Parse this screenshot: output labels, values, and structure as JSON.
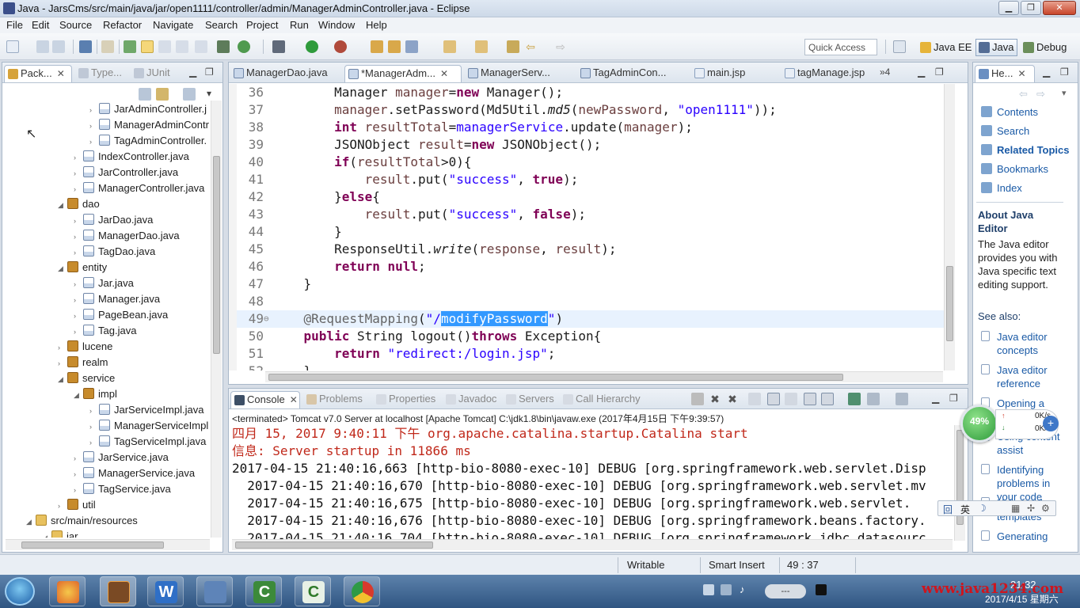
{
  "window": {
    "title": "Java - JarsCms/src/main/java/jar/open1111/controller/admin/ManagerAdminController.java - Eclipse",
    "controls": [
      "▁",
      "❐",
      "✕"
    ]
  },
  "menu": [
    "File",
    "Edit",
    "Source",
    "Refactor",
    "Navigate",
    "Search",
    "Project",
    "Run",
    "Window",
    "Help"
  ],
  "toolbar": {
    "quick_access": "Quick Access",
    "perspectives": [
      {
        "label": "Java EE",
        "active": false
      },
      {
        "label": "Java",
        "active": true
      },
      {
        "label": "Debug",
        "active": false
      }
    ]
  },
  "explorer": {
    "tabs": [
      {
        "label": "Pack...",
        "active": true
      },
      {
        "label": "Type...",
        "active": false
      },
      {
        "label": "JUnit",
        "active": false
      }
    ],
    "items": [
      {
        "label": "JarAdminController.j",
        "kind": "java",
        "level": 5,
        "toggle": "›"
      },
      {
        "label": "ManagerAdminContr",
        "kind": "java",
        "level": 5,
        "toggle": "›"
      },
      {
        "label": "TagAdminController.",
        "kind": "java",
        "level": 5,
        "toggle": "›"
      },
      {
        "label": "IndexController.java",
        "kind": "java",
        "level": 4,
        "toggle": "›"
      },
      {
        "label": "JarController.java",
        "kind": "java",
        "level": 4,
        "toggle": "›"
      },
      {
        "label": "ManagerController.java",
        "kind": "java",
        "level": 4,
        "toggle": "›"
      },
      {
        "label": "dao",
        "kind": "package",
        "level": 3,
        "toggle": "◢"
      },
      {
        "label": "JarDao.java",
        "kind": "java",
        "level": 4,
        "toggle": "›"
      },
      {
        "label": "ManagerDao.java",
        "kind": "java",
        "level": 4,
        "toggle": "›"
      },
      {
        "label": "TagDao.java",
        "kind": "java",
        "level": 4,
        "toggle": "›"
      },
      {
        "label": "entity",
        "kind": "package",
        "level": 3,
        "toggle": "◢"
      },
      {
        "label": "Jar.java",
        "kind": "java",
        "level": 4,
        "toggle": "›"
      },
      {
        "label": "Manager.java",
        "kind": "java",
        "level": 4,
        "toggle": "›"
      },
      {
        "label": "PageBean.java",
        "kind": "java",
        "level": 4,
        "toggle": "›"
      },
      {
        "label": "Tag.java",
        "kind": "java",
        "level": 4,
        "toggle": "›"
      },
      {
        "label": "lucene",
        "kind": "package",
        "level": 3,
        "toggle": "›"
      },
      {
        "label": "realm",
        "kind": "package",
        "level": 3,
        "toggle": "›"
      },
      {
        "label": "service",
        "kind": "package",
        "level": 3,
        "toggle": "◢"
      },
      {
        "label": "impl",
        "kind": "package",
        "level": 4,
        "toggle": "◢"
      },
      {
        "label": "JarServiceImpl.java",
        "kind": "java",
        "level": 5,
        "toggle": "›"
      },
      {
        "label": "ManagerServiceImpl",
        "kind": "java",
        "level": 5,
        "toggle": "›"
      },
      {
        "label": "TagServiceImpl.java",
        "kind": "java",
        "level": 5,
        "toggle": "›"
      },
      {
        "label": "JarService.java",
        "kind": "java",
        "level": 4,
        "toggle": "›"
      },
      {
        "label": "ManagerService.java",
        "kind": "java",
        "level": 4,
        "toggle": "›"
      },
      {
        "label": "TagService.java",
        "kind": "java",
        "level": 4,
        "toggle": "›"
      },
      {
        "label": "util",
        "kind": "package",
        "level": 3,
        "toggle": "›"
      },
      {
        "label": "src/main/resources",
        "kind": "folder",
        "level": 1,
        "toggle": "◢"
      },
      {
        "label": "jar",
        "kind": "folder",
        "level": 2,
        "toggle": "◢"
      }
    ]
  },
  "editor": {
    "tabs": [
      {
        "label": "ManagerDao.java",
        "active": false,
        "closable": false
      },
      {
        "label": "*ManagerAdm...",
        "active": true,
        "closable": true
      },
      {
        "label": "ManagerServ...",
        "active": false,
        "closable": false
      },
      {
        "label": "TagAdminCon...",
        "active": false,
        "closable": false
      },
      {
        "label": "main.jsp",
        "active": false,
        "closable": false
      },
      {
        "label": "tagManage.jsp",
        "active": false,
        "closable": false
      }
    ],
    "overflow": "»4",
    "lines": [
      {
        "n": "36",
        "tokens": [
          {
            "t": "        Manager "
          },
          {
            "t": "manager",
            "c": "var"
          },
          {
            "t": "="
          },
          {
            "t": "new",
            "c": "kw"
          },
          {
            "t": " Manager();"
          }
        ]
      },
      {
        "n": "37",
        "tokens": [
          {
            "t": "        "
          },
          {
            "t": "manager",
            "c": "var"
          },
          {
            "t": ".setPassword(Md5Util."
          },
          {
            "t": "md5",
            "c": "it"
          },
          {
            "t": "("
          },
          {
            "t": "newPassword",
            "c": "var"
          },
          {
            "t": ", "
          },
          {
            "t": "\"open1111\"",
            "c": "str"
          },
          {
            "t": "));"
          }
        ]
      },
      {
        "n": "38",
        "tokens": [
          {
            "t": "        "
          },
          {
            "t": "int",
            "c": "kw"
          },
          {
            "t": " "
          },
          {
            "t": "resultTotal",
            "c": "var"
          },
          {
            "t": "="
          },
          {
            "t": "managerService",
            "c": "str"
          },
          {
            "t": ".update("
          },
          {
            "t": "manager",
            "c": "var"
          },
          {
            "t": ");"
          }
        ]
      },
      {
        "n": "39",
        "tokens": [
          {
            "t": "        JSONObject "
          },
          {
            "t": "result",
            "c": "var"
          },
          {
            "t": "="
          },
          {
            "t": "new",
            "c": "kw"
          },
          {
            "t": " JSONObject();"
          }
        ]
      },
      {
        "n": "40",
        "tokens": [
          {
            "t": "        "
          },
          {
            "t": "if",
            "c": "kw"
          },
          {
            "t": "("
          },
          {
            "t": "resultTotal",
            "c": "var"
          },
          {
            "t": ">0){"
          }
        ]
      },
      {
        "n": "41",
        "tokens": [
          {
            "t": "            "
          },
          {
            "t": "result",
            "c": "var"
          },
          {
            "t": ".put("
          },
          {
            "t": "\"success\"",
            "c": "str"
          },
          {
            "t": ", "
          },
          {
            "t": "true",
            "c": "kw"
          },
          {
            "t": ");"
          }
        ]
      },
      {
        "n": "42",
        "tokens": [
          {
            "t": "        }"
          },
          {
            "t": "else",
            "c": "kw"
          },
          {
            "t": "{"
          }
        ]
      },
      {
        "n": "43",
        "tokens": [
          {
            "t": "            "
          },
          {
            "t": "result",
            "c": "var"
          },
          {
            "t": ".put("
          },
          {
            "t": "\"success\"",
            "c": "str"
          },
          {
            "t": ", "
          },
          {
            "t": "false",
            "c": "kw"
          },
          {
            "t": ");"
          }
        ]
      },
      {
        "n": "44",
        "tokens": [
          {
            "t": "        }"
          }
        ]
      },
      {
        "n": "45",
        "tokens": [
          {
            "t": "        ResponseUtil."
          },
          {
            "t": "write",
            "c": "it"
          },
          {
            "t": "("
          },
          {
            "t": "response",
            "c": "var"
          },
          {
            "t": ", "
          },
          {
            "t": "result",
            "c": "var"
          },
          {
            "t": ");"
          }
        ]
      },
      {
        "n": "46",
        "tokens": [
          {
            "t": "        "
          },
          {
            "t": "return",
            "c": "kw"
          },
          {
            "t": " "
          },
          {
            "t": "null",
            "c": "kw"
          },
          {
            "t": ";"
          }
        ]
      },
      {
        "n": "47",
        "tokens": [
          {
            "t": "    }"
          }
        ]
      },
      {
        "n": "48",
        "tokens": [
          {
            "t": ""
          }
        ]
      },
      {
        "n": "49",
        "fold": "⊖",
        "current": true,
        "tokens": [
          {
            "t": "    "
          },
          {
            "t": "@RequestMapping",
            "c": "ann"
          },
          {
            "t": "("
          },
          {
            "t": "\"/",
            "c": "str"
          },
          {
            "t": "modifyPassword",
            "c": "sel"
          },
          {
            "t": "\"",
            "c": "str"
          },
          {
            "t": ")"
          }
        ]
      },
      {
        "n": "50",
        "tokens": [
          {
            "t": "    "
          },
          {
            "t": "public",
            "c": "kw"
          },
          {
            "t": " String logout()"
          },
          {
            "t": "throws",
            "c": "kw"
          },
          {
            "t": " Exception{"
          }
        ]
      },
      {
        "n": "51",
        "tokens": [
          {
            "t": "        "
          },
          {
            "t": "return",
            "c": "kw"
          },
          {
            "t": " "
          },
          {
            "t": "\"redirect:/login.jsp\"",
            "c": "str"
          },
          {
            "t": ";"
          }
        ]
      },
      {
        "n": "52",
        "tokens": [
          {
            "t": "    }"
          }
        ]
      }
    ]
  },
  "console": {
    "tabs": [
      {
        "label": "Console",
        "active": true
      },
      {
        "label": "Problems",
        "active": false
      },
      {
        "label": "Properties",
        "active": false
      },
      {
        "label": "Javadoc",
        "active": false
      },
      {
        "label": "Servers",
        "active": false
      },
      {
        "label": "Call Hierarchy",
        "active": false
      }
    ],
    "header": "<terminated> Tomcat v7.0 Server at localhost [Apache Tomcat] C:\\jdk1.8\\bin\\javaw.exe (2017年4月15日 下午9:39:57)",
    "lines": [
      {
        "text": "四月 15, 2017 9:40:11 下午 org.apache.catalina.startup.Catalina start",
        "red": true
      },
      {
        "text": "信息: Server startup in 11866 ms",
        "red": true
      },
      {
        "text": "2017-04-15 21:40:16,663 [http-bio-8080-exec-10] DEBUG [org.springframework.web.servlet.Disp",
        "red": false
      },
      {
        "text": "  2017-04-15 21:40:16,670 [http-bio-8080-exec-10] DEBUG [org.springframework.web.servlet.mv",
        "red": false
      },
      {
        "text": "  2017-04-15 21:40:16,675 [http-bio-8080-exec-10] DEBUG [org.springframework.web.servlet.",
        "red": false
      },
      {
        "text": "  2017-04-15 21:40:16,676 [http-bio-8080-exec-10] DEBUG [org.springframework.beans.factory.",
        "red": false
      },
      {
        "text": "  2017-04-15 21:40:16,704 [http-bio-8080-exec-10] DEBUG [org.springframework.jdbc.datasourc",
        "red": false
      }
    ]
  },
  "help": {
    "tab": "He...",
    "links": [
      "Contents",
      "Search",
      "Related Topics",
      "Bookmarks",
      "Index"
    ],
    "section_title": "About Java Editor",
    "body": "The Java editor provides you with Java specific text editing support.",
    "see_also": "See also:",
    "see_also_links": [
      "Java editor concepts",
      "Java editor reference",
      "Opening a Java editor",
      "Using content assist",
      "Identifying problems in your code",
      "Using code templates",
      "Generating"
    ]
  },
  "status": {
    "mode": "Writable",
    "insert": "Smart Insert",
    "position": "49 : 37"
  },
  "net_widget": {
    "percent": "49%",
    "up": "0K/s",
    "down": "0K/s"
  },
  "ime_bar": {
    "lang": "英"
  },
  "taskbar": {
    "apps": [
      "windows-explorer",
      "java-ee-eclipse",
      "wps-writer",
      "sqlyog",
      "camtasia",
      "camtasia-recorder",
      "chrome"
    ],
    "time": "21:32",
    "date": "2017/4/15 星期六",
    "watermark": "www.java1234.com"
  }
}
